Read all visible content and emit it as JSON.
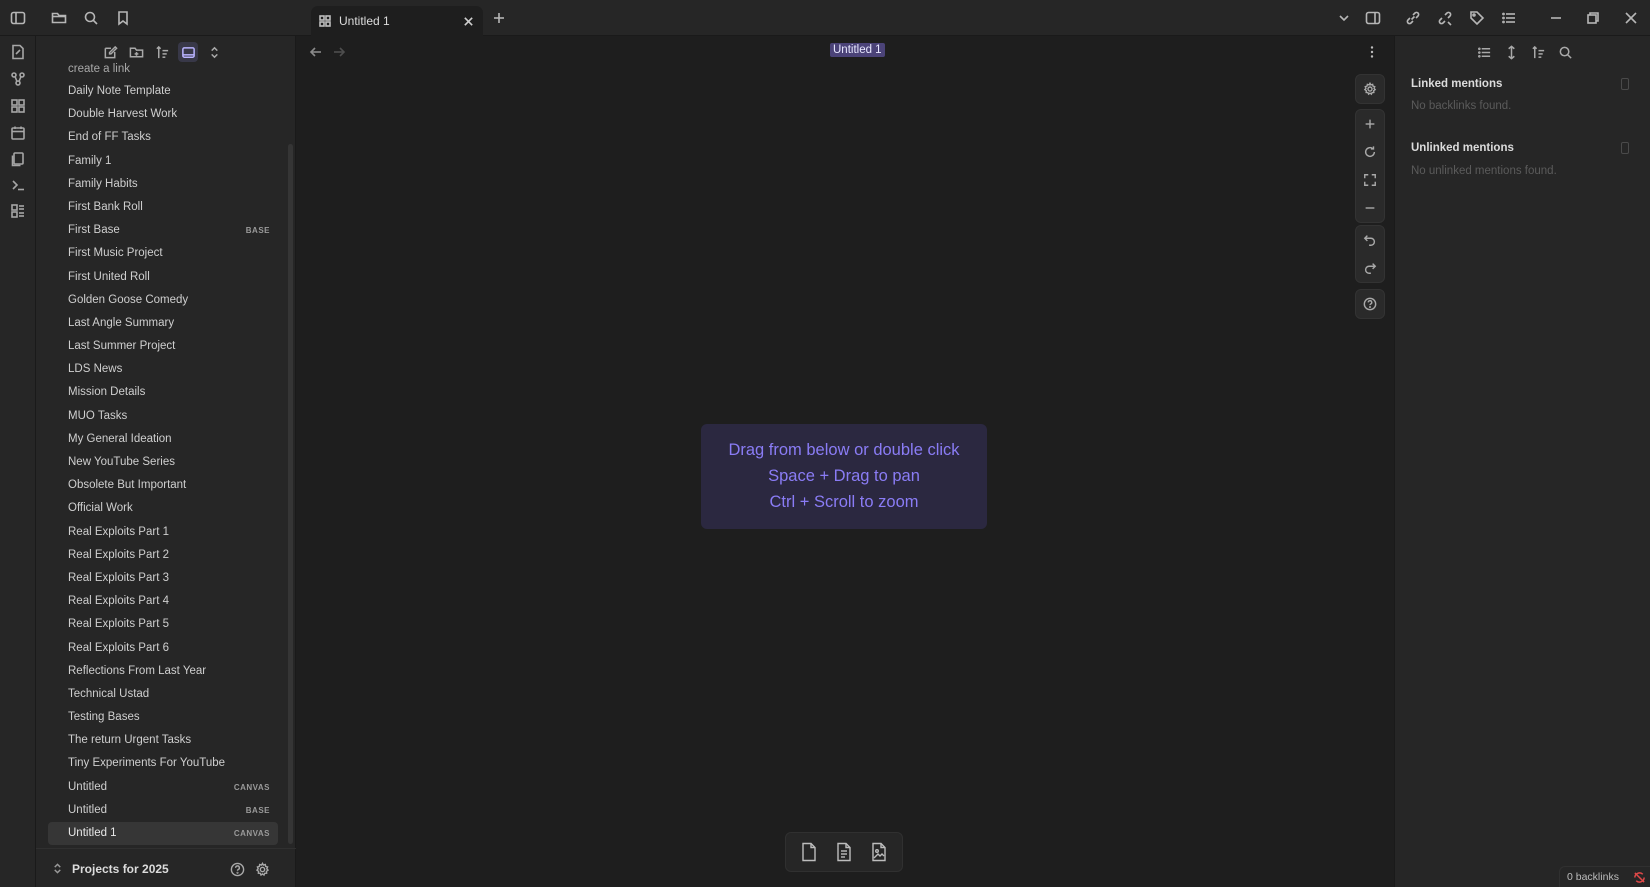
{
  "tab": {
    "title": "Untitled 1"
  },
  "view": {
    "title": "Untitled 1"
  },
  "files": [
    {
      "label": "create a link",
      "badge": ""
    },
    {
      "label": "Daily Note Template",
      "badge": ""
    },
    {
      "label": "Double Harvest Work",
      "badge": ""
    },
    {
      "label": "End of FF Tasks",
      "badge": ""
    },
    {
      "label": "Family 1",
      "badge": ""
    },
    {
      "label": "Family Habits",
      "badge": ""
    },
    {
      "label": "First Bank Roll",
      "badge": ""
    },
    {
      "label": "First Base",
      "badge": "BASE"
    },
    {
      "label": "First Music Project",
      "badge": ""
    },
    {
      "label": "First United Roll",
      "badge": ""
    },
    {
      "label": "Golden Goose Comedy",
      "badge": ""
    },
    {
      "label": "Last Angle Summary",
      "badge": ""
    },
    {
      "label": "Last Summer Project",
      "badge": ""
    },
    {
      "label": "LDS News",
      "badge": ""
    },
    {
      "label": "Mission Details",
      "badge": ""
    },
    {
      "label": "MUO Tasks",
      "badge": ""
    },
    {
      "label": "My General Ideation",
      "badge": ""
    },
    {
      "label": "New YouTube Series",
      "badge": ""
    },
    {
      "label": "Obsolete But Important",
      "badge": ""
    },
    {
      "label": "Official Work",
      "badge": ""
    },
    {
      "label": "Real Exploits Part 1",
      "badge": ""
    },
    {
      "label": "Real Exploits Part 2",
      "badge": ""
    },
    {
      "label": "Real Exploits Part 3",
      "badge": ""
    },
    {
      "label": "Real Exploits Part 4",
      "badge": ""
    },
    {
      "label": "Real Exploits Part 5",
      "badge": ""
    },
    {
      "label": "Real Exploits Part 6",
      "badge": ""
    },
    {
      "label": "Reflections From Last Year",
      "badge": ""
    },
    {
      "label": "Technical Ustad",
      "badge": ""
    },
    {
      "label": "Testing Bases",
      "badge": ""
    },
    {
      "label": "The return Urgent Tasks",
      "badge": ""
    },
    {
      "label": "Tiny Experiments For YouTube",
      "badge": ""
    },
    {
      "label": "Untitled",
      "badge": "CANVAS"
    },
    {
      "label": "Untitled",
      "badge": "BASE"
    },
    {
      "label": "Untitled 1",
      "badge": "CANVAS"
    }
  ],
  "vault": {
    "name": "Projects for 2025"
  },
  "canvas_hint": {
    "line1": "Drag from below or double click",
    "line2": "Space + Drag to pan",
    "line3": "Ctrl + Scroll to zoom"
  },
  "backlinks": {
    "linked_heading": "Linked mentions",
    "linked_empty": "No backlinks found.",
    "unlinked_heading": "Unlinked mentions",
    "unlinked_empty": "No unlinked mentions found."
  },
  "status": {
    "backlinks": "0 backlinks"
  },
  "colors": {
    "accent": "#8a7cf5",
    "hint_bg": "#2b2840",
    "sync_error": "#e04848"
  }
}
